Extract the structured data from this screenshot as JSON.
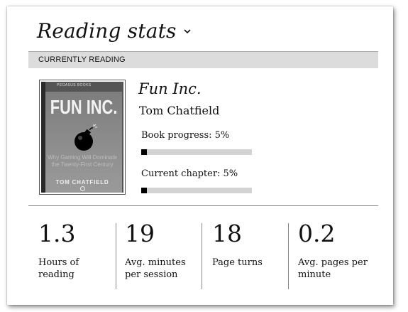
{
  "header": {
    "title": "Reading stats",
    "dropdown_icon": "chevron-down-icon"
  },
  "section": {
    "label": "CURRENTLY READING"
  },
  "book": {
    "title": "Fun Inc.",
    "author": "Tom Chatfield",
    "cover": {
      "top_text": "PEGASUS BOOKS",
      "title": "FUN INC.",
      "subtitle": "Why Gaming Will Dominate the Twenty-First Century",
      "author": "TOM CHATFIELD",
      "icon": "bomb-icon"
    },
    "progress": {
      "label": "Book progress: 5%",
      "fraction": 0.05
    },
    "chapter": {
      "label": "Current chapter: 5%",
      "fraction": 0.05
    }
  },
  "stats": [
    {
      "value": "1.3",
      "label": "Hours of reading"
    },
    {
      "value": "19",
      "label": "Avg. minutes per session"
    },
    {
      "value": "18",
      "label": "Page turns"
    },
    {
      "value": "0.2",
      "label": "Avg. pages per minute"
    }
  ],
  "colors": {
    "section_bg": "#dcdcdc",
    "progress_fill": "#000000",
    "progress_track": "#d3d3d3"
  }
}
